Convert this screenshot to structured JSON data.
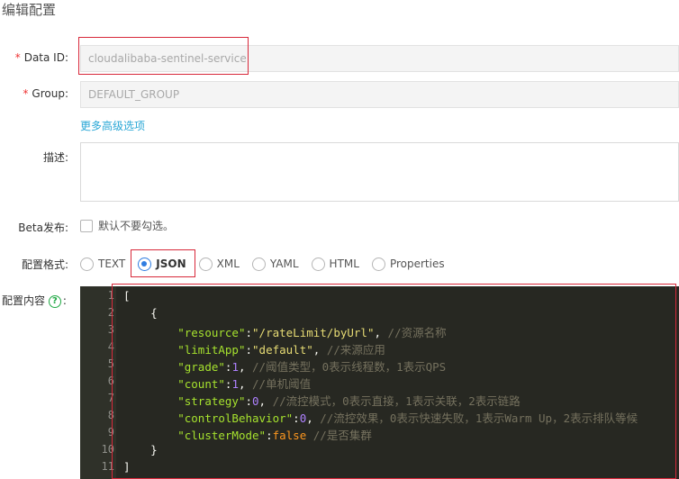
{
  "page": {
    "title": "编辑配置"
  },
  "form": {
    "data_id": {
      "label": "Data ID:",
      "value": "cloudalibaba-sentinel-service",
      "required": true
    },
    "group": {
      "label": "Group:",
      "value": "DEFAULT_GROUP",
      "required": true
    },
    "advanced_link": "更多高级选项",
    "description": {
      "label": "描述:",
      "value": ""
    },
    "beta": {
      "label": "Beta发布:",
      "checkbox_text": "默认不要勾选。",
      "checked": false
    },
    "format": {
      "label": "配置格式:",
      "options": [
        "TEXT",
        "JSON",
        "XML",
        "YAML",
        "HTML",
        "Properties"
      ],
      "selected": "JSON"
    },
    "content": {
      "label": "配置内容",
      "help_icon": "question-circle-icon"
    }
  },
  "editor": {
    "line_numbers": [
      "1",
      "2",
      "3",
      "4",
      "5",
      "6",
      "7",
      "8",
      "9",
      "10",
      "11"
    ],
    "lines": [
      [
        {
          "t": "[",
          "c": ""
        }
      ],
      [
        {
          "t": "    {",
          "c": ""
        }
      ],
      [
        {
          "t": "        ",
          "c": ""
        },
        {
          "t": "\"resource\"",
          "c": "k"
        },
        {
          "t": ":",
          "c": ""
        },
        {
          "t": "\"/rateLimit/byUrl\"",
          "c": "s"
        },
        {
          "t": ", ",
          "c": ""
        },
        {
          "t": "//资源名称",
          "c": "c"
        }
      ],
      [
        {
          "t": "        ",
          "c": ""
        },
        {
          "t": "\"limitApp\"",
          "c": "k"
        },
        {
          "t": ":",
          "c": ""
        },
        {
          "t": "\"default\"",
          "c": "s"
        },
        {
          "t": ", ",
          "c": ""
        },
        {
          "t": "//来源应用",
          "c": "c"
        }
      ],
      [
        {
          "t": "        ",
          "c": ""
        },
        {
          "t": "\"grade\"",
          "c": "k"
        },
        {
          "t": ":",
          "c": ""
        },
        {
          "t": "1",
          "c": "n"
        },
        {
          "t": ", ",
          "c": ""
        },
        {
          "t": "//阈值类型，0表示线程数，1表示QPS",
          "c": "c"
        }
      ],
      [
        {
          "t": "        ",
          "c": ""
        },
        {
          "t": "\"count\"",
          "c": "k"
        },
        {
          "t": ":",
          "c": ""
        },
        {
          "t": "1",
          "c": "n"
        },
        {
          "t": ", ",
          "c": ""
        },
        {
          "t": "//单机阈值",
          "c": "c"
        }
      ],
      [
        {
          "t": "        ",
          "c": ""
        },
        {
          "t": "\"strategy\"",
          "c": "k"
        },
        {
          "t": ":",
          "c": ""
        },
        {
          "t": "0",
          "c": "n"
        },
        {
          "t": ", ",
          "c": ""
        },
        {
          "t": "//流控模式，0表示直接，1表示关联，2表示链路",
          "c": "c"
        }
      ],
      [
        {
          "t": "        ",
          "c": ""
        },
        {
          "t": "\"controlBehavior\"",
          "c": "k"
        },
        {
          "t": ":",
          "c": ""
        },
        {
          "t": "0",
          "c": "n"
        },
        {
          "t": ", ",
          "c": ""
        },
        {
          "t": "//流控效果，0表示快速失败，1表示Warm Up，2表示排队等候",
          "c": "c"
        }
      ],
      [
        {
          "t": "        ",
          "c": ""
        },
        {
          "t": "\"clusterMode\"",
          "c": "k"
        },
        {
          "t": ":",
          "c": ""
        },
        {
          "t": "false",
          "c": "kw"
        },
        {
          "t": " ",
          "c": ""
        },
        {
          "t": "//是否集群",
          "c": "c"
        }
      ],
      [
        {
          "t": "    }",
          "c": ""
        }
      ],
      [
        {
          "t": "]",
          "c": ""
        }
      ]
    ]
  },
  "colors": {
    "accent": "#2f7de1",
    "highlight_outline": "#d8283a",
    "link": "#2aa7d6",
    "editor_bg": "#272822"
  }
}
